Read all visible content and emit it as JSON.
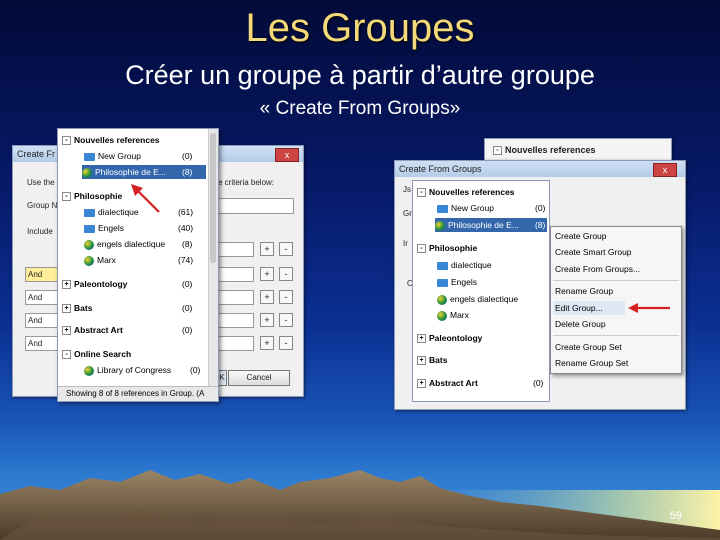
{
  "slide": {
    "title": "Les Groupes",
    "subtitle": "Créer un groupe à partir d’autre groupe",
    "subtitle2": "« Create From Groups»",
    "page_number": "59"
  },
  "left_dialog": {
    "title": "Create Fr",
    "close": "x",
    "labels": [
      "Use the",
      "Group N",
      "Include"
    ],
    "criteria_text": "e criteria below:",
    "ops": [
      "And",
      "And",
      "And",
      "And"
    ],
    "plus": "+",
    "minus": "-",
    "cancel": "Cancel",
    "ok": "OK"
  },
  "left_tree": {
    "items": [
      {
        "label": "Nouvelles references",
        "count": "",
        "kind": "header",
        "pm": "-"
      },
      {
        "label": "New Group",
        "count": "(0)",
        "kind": "folder"
      },
      {
        "label": "Philosophie de E...",
        "count": "(8)",
        "kind": "smart",
        "selected": true
      },
      {
        "label": "Philosophie",
        "count": "",
        "kind": "header",
        "pm": "-"
      },
      {
        "label": "dialectique",
        "count": "(61)",
        "kind": "folder"
      },
      {
        "label": "Engels",
        "count": "(40)",
        "kind": "folder"
      },
      {
        "label": "engels dialectique",
        "count": "(8)",
        "kind": "smart"
      },
      {
        "label": "Marx",
        "count": "(74)",
        "kind": "smart"
      },
      {
        "label": "Paleontology",
        "count": "(0)",
        "kind": "header",
        "pm": "+"
      },
      {
        "label": "Bats",
        "count": "(0)",
        "kind": "header",
        "pm": "+"
      },
      {
        "label": "Abstract Art",
        "count": "(0)",
        "kind": "header",
        "pm": "+"
      },
      {
        "label": "Online Search",
        "count": "",
        "kind": "header",
        "pm": "-"
      },
      {
        "label": "Library of Congress",
        "count": "(0)",
        "kind": "globe"
      }
    ],
    "status": "Showing 8 of 8 references in Group. (A"
  },
  "right_dialog": {
    "title": "Create From Groups",
    "close": "x",
    "behind_label": "Nouvelles references",
    "labels": [
      "Js",
      "Gr",
      "Ir",
      "O"
    ]
  },
  "right_tree": {
    "items": [
      {
        "label": "Nouvelles references",
        "count": "",
        "kind": "header",
        "pm": "-"
      },
      {
        "label": "New Group",
        "count": "(0)",
        "kind": "folder"
      },
      {
        "label": "Philosophie de E...",
        "count": "(8)",
        "kind": "smart",
        "selected": true
      },
      {
        "label": "Philosophie",
        "count": "",
        "kind": "header",
        "pm": "-"
      },
      {
        "label": "dialectique",
        "count": "",
        "kind": "folder"
      },
      {
        "label": "Engels",
        "count": "",
        "kind": "folder"
      },
      {
        "label": "engels dialectique",
        "count": "",
        "kind": "smart"
      },
      {
        "label": "Marx",
        "count": "",
        "kind": "smart"
      },
      {
        "label": "Paleontology",
        "count": "",
        "kind": "header",
        "pm": "+"
      },
      {
        "label": "Bats",
        "count": "",
        "kind": "header",
        "pm": "+"
      },
      {
        "label": "Abstract Art",
        "count": "(0)",
        "kind": "header",
        "pm": "+"
      }
    ]
  },
  "context_menu": {
    "items": [
      "Create Group",
      "Create Smart Group",
      "Create From Groups...",
      "Rename Group",
      "Edit Group...",
      "Delete Group",
      "Create Group Set",
      "Rename Group Set"
    ]
  },
  "colors": {
    "title": "#f4d97a",
    "selection": "#3366aa",
    "arrow": "#d42020"
  }
}
